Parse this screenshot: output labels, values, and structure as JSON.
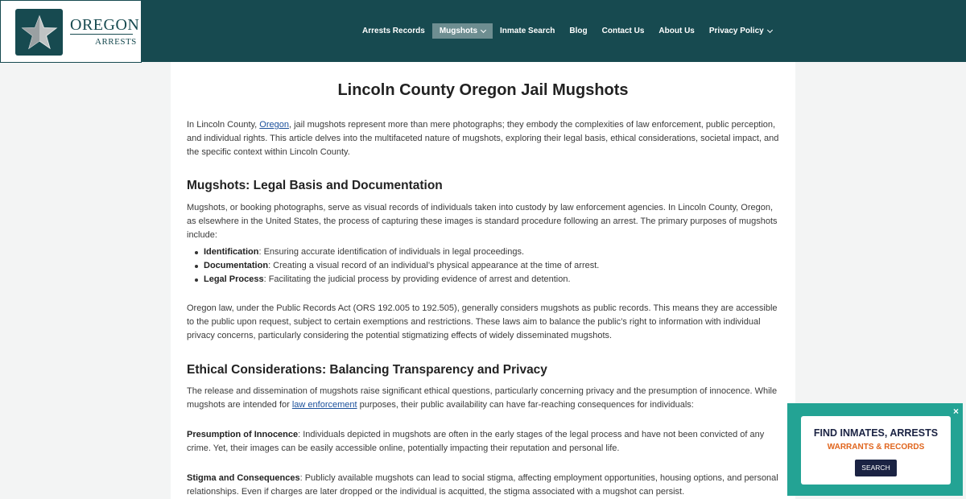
{
  "brand": {
    "name_line1": "OREGON",
    "name_line2": "ARRESTS",
    "emblem_icon": "star-icon",
    "color": "#174a50"
  },
  "nav": {
    "items": [
      {
        "label": "Arrests Records",
        "dropdown": false
      },
      {
        "label": "Mugshots",
        "dropdown": true,
        "active": true
      },
      {
        "label": "Inmate Search",
        "dropdown": false
      },
      {
        "label": "Blog",
        "dropdown": false
      },
      {
        "label": "Contact Us",
        "dropdown": false
      },
      {
        "label": "About Us",
        "dropdown": false
      },
      {
        "label": "Privacy Policy",
        "dropdown": true
      }
    ]
  },
  "article": {
    "title": "Lincoln County Oregon Jail Mugshots",
    "intro": {
      "pre": "In Lincoln County, ",
      "link": "Oregon",
      "post": ", jail mugshots represent more than mere photographs; they embody the complexities of law enforcement, public perception, and individual rights. This article delves into the multifaceted nature of mugshots, exploring their legal basis, ethical considerations, societal impact, and the specific context within Lincoln County."
    },
    "section1": {
      "heading": "Mugshots: Legal Basis and Documentation",
      "p1": "Mugshots, or booking photographs, serve as visual records of individuals taken into custody by law enforcement agencies. In Lincoln County, Oregon, as elsewhere in the United States, the process of capturing these images is standard procedure following an arrest. The primary purposes of mugshots include:",
      "bullets": [
        {
          "term": "Identification",
          "text": ": Ensuring accurate identification of individuals in legal proceedings."
        },
        {
          "term": "Documentation",
          "text": ": Creating a visual record of an individual’s physical appearance at the time of arrest."
        },
        {
          "term": "Legal Process",
          "text": ": Facilitating the judicial process by providing evidence of arrest and detention."
        }
      ],
      "p2": "Oregon law, under the Public Records Act (ORS 192.005 to 192.505), generally considers mugshots as public records. This means they are accessible to the public upon request, subject to certain exemptions and restrictions. These laws aim to balance the public’s right to information with individual privacy concerns, particularly considering the potential stigmatizing effects of widely disseminated mugshots."
    },
    "section2": {
      "heading": "Ethical Considerations: Balancing Transparency and Privacy",
      "p1_pre": "The release and dissemination of mugshots raise significant ethical questions, particularly concerning privacy and the presumption of innocence. While mugshots are intended for ",
      "p1_link": "law enforcement",
      "p1_post": " purposes, their public availability can have far-reaching consequences for individuals:",
      "p2_term": "Presumption of Innocence",
      "p2_text": ": Individuals depicted in mugshots are often in the early stages of the legal process and have not been convicted of any crime. Yet, their images can be easily accessible online, potentially impacting their reputation and personal life.",
      "p3_term": "Stigma and Consequences",
      "p3_text": ": Publicly available mugshots can lead to social stigma, affecting employment opportunities, housing options, and personal relationships. Even if charges are later dropped or the individual is acquitted, the stigma associated with a mugshot can persist."
    }
  },
  "popup": {
    "close_label": "×",
    "title": "FIND INMATES, ARRESTS",
    "subtitle": "WARRANTS & RECORDS",
    "button": "SEARCH",
    "bg_color": "#23a394",
    "accent_color": "#e0651d"
  }
}
